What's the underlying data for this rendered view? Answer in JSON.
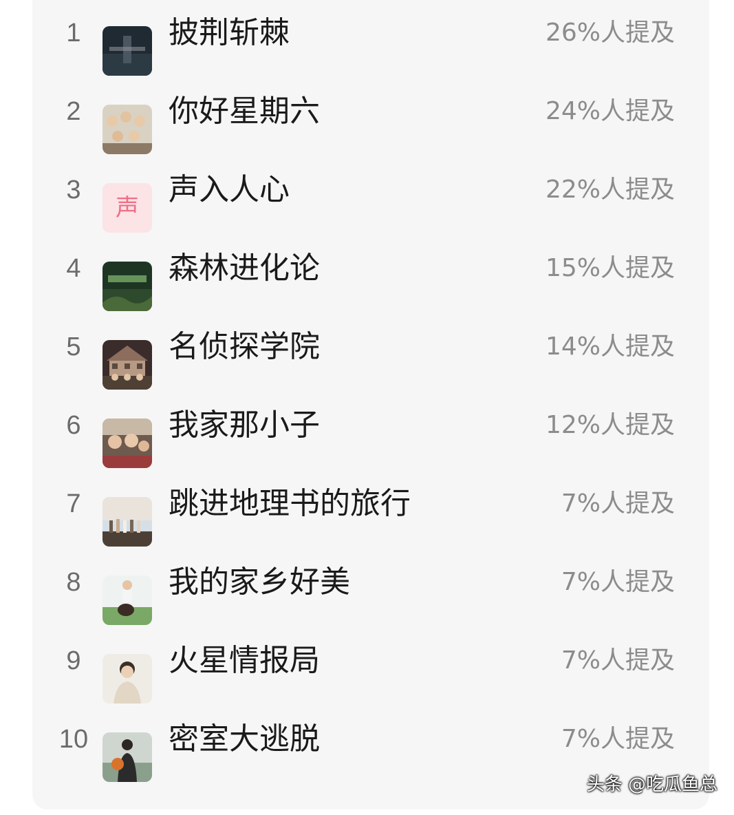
{
  "ranking": [
    {
      "rank": "1",
      "title": "披荆斩棘",
      "mention": "26%人提及",
      "thumb": "dark-poster"
    },
    {
      "rank": "2",
      "title": "你好星期六",
      "mention": "24%人提及",
      "thumb": "group-photo"
    },
    {
      "rank": "3",
      "title": "声入人心",
      "mention": "22%人提及",
      "thumb": "text-badge",
      "badge_text": "声"
    },
    {
      "rank": "4",
      "title": "森林进化论",
      "mention": "15%人提及",
      "thumb": "forest-poster"
    },
    {
      "rank": "5",
      "title": "名侦探学院",
      "mention": "14%人提及",
      "thumb": "house-group"
    },
    {
      "rank": "6",
      "title": "我家那小子",
      "mention": "12%人提及",
      "thumb": "family-photo"
    },
    {
      "rank": "7",
      "title": "跳进地理书的旅行",
      "mention": "7%人提及",
      "thumb": "sky-group"
    },
    {
      "rank": "8",
      "title": "我的家乡好美",
      "mention": "7%人提及",
      "thumb": "rider-photo"
    },
    {
      "rank": "9",
      "title": "火星情报局",
      "mention": "7%人提及",
      "thumb": "portrait-photo"
    },
    {
      "rank": "10",
      "title": "密室大逃脱",
      "mention": "7%人提及",
      "thumb": "basketball-photo"
    }
  ],
  "watermark": "头条 @吃瓜鱼总",
  "colors": {
    "card_bg": "#f6f6f6",
    "rank_text": "#6b6b6b",
    "title_text": "#1a1a1a",
    "mention_text": "#8c8c8c",
    "badge_bg": "#fbe3e6",
    "badge_text": "#ef6f86"
  }
}
